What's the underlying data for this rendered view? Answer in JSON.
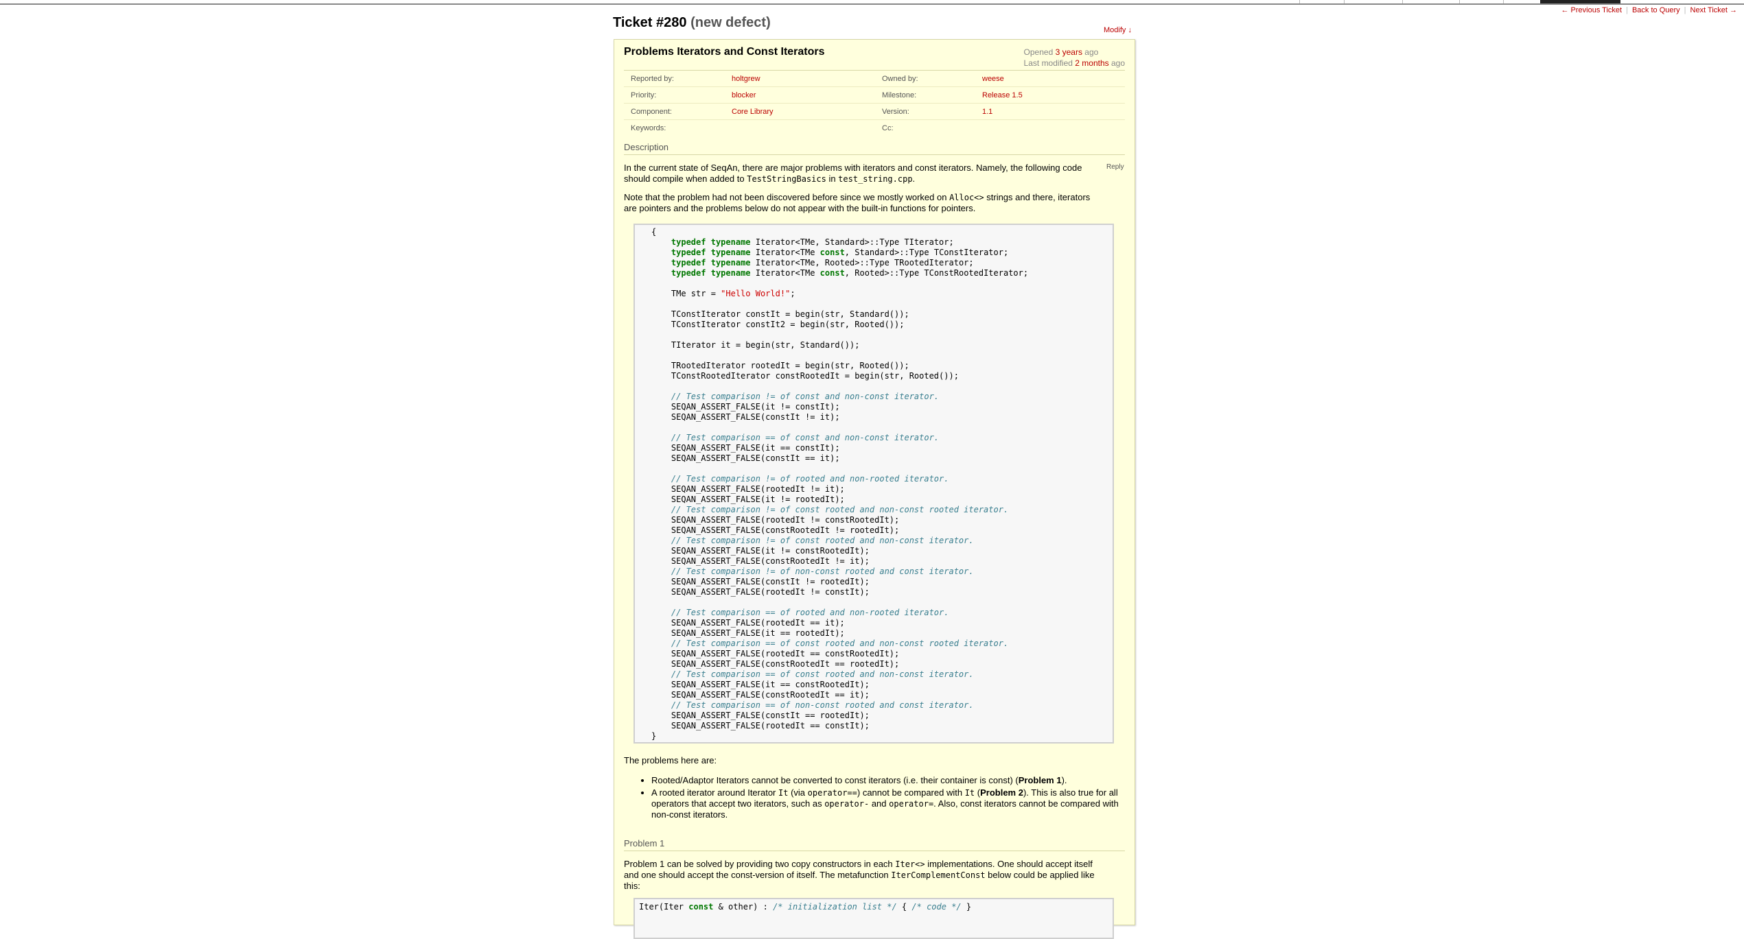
{
  "nav": {
    "prev": "← Previous Ticket",
    "back": "Back to Query",
    "next": "Next Ticket →"
  },
  "ticket": {
    "id_label": "Ticket #280",
    "status": "(new defect)",
    "modify_label": "Modify ↓",
    "summary": "Problems Iterators and Const Iterators",
    "opened_prefix": "Opened",
    "opened_ago": "3 years",
    "opened_suffix": "ago",
    "modified_prefix": "Last modified",
    "modified_ago": "2 months",
    "modified_suffix": "ago",
    "props": {
      "reported_by_label": "Reported by:",
      "reported_by": "holtgrew",
      "owned_by_label": "Owned by:",
      "owned_by": "weese",
      "priority_label": "Priority:",
      "priority": "blocker",
      "milestone_label": "Milestone:",
      "milestone": "Release 1.5",
      "component_label": "Component:",
      "component": "Core Library",
      "version_label": "Version:",
      "version": "1.1",
      "keywords_label": "Keywords:",
      "cc_label": "Cc:"
    },
    "description_heading": "Description",
    "reply_label": "Reply",
    "desc_p1_a": "In the current state of SeqAn, there are major problems with iterators and const iterators. Namely, the following code should compile when added to ",
    "desc_p1_code1": "TestStringBasics",
    "desc_p1_b": " in ",
    "desc_p1_code2": "test_string.cpp",
    "desc_p1_c": ".",
    "desc_p2_a": "Note that the problem had not been discovered before since we mostly worked on ",
    "desc_p2_code": "Alloc<>",
    "desc_p2_b": " strings and there, iterators are pointers and the problems below do not appear with the built-in functions for pointers.",
    "problems_intro": "The problems here are:",
    "bullet1_a": "Rooted/Adaptor Iterators cannot be converted to const iterators (i.e. their container is const) (",
    "bullet1_b": "Problem 1",
    "bullet1_c": ").",
    "bullet2_a": "A rooted iterator around Iterator ",
    "bullet2_code1": "It",
    "bullet2_b": " (via ",
    "bullet2_code2": "operator==",
    "bullet2_c": ") cannot be compared with ",
    "bullet2_code3": "It",
    "bullet2_d": " (",
    "bullet2_e": "Problem 2",
    "bullet2_f": "). This is also true for all operators that accept two iterators, such as ",
    "bullet2_code4": "operator-",
    "bullet2_g": " and ",
    "bullet2_code5": "operator=",
    "bullet2_h": ". Also, const iterators cannot be compared with non-const iterators.",
    "problem1_heading": "Problem 1",
    "problem1_a": "Problem 1 can be solved by providing two copy constructors in each ",
    "problem1_code1": "Iter<>",
    "problem1_b": " implementations. One should accept itself and one should accept the const-version of itself. The metafunction ",
    "problem1_code2": "IterComplementConst",
    "problem1_c": " below could be applied like this:"
  },
  "code_lines": [
    {
      "indent": 0,
      "parts": [
        {
          "t": "{"
        }
      ]
    },
    {
      "indent": 4,
      "parts": [
        {
          "k": "typedef"
        },
        {
          "t": " "
        },
        {
          "k": "typename"
        },
        {
          "t": " Iterator<TMe, Standard>::Type TIterator;"
        }
      ]
    },
    {
      "indent": 4,
      "parts": [
        {
          "k": "typedef"
        },
        {
          "t": " "
        },
        {
          "k": "typename"
        },
        {
          "t": " Iterator<TMe "
        },
        {
          "k": "const"
        },
        {
          "t": ", Standard>::Type TConstIterator;"
        }
      ]
    },
    {
      "indent": 4,
      "parts": [
        {
          "k": "typedef"
        },
        {
          "t": " "
        },
        {
          "k": "typename"
        },
        {
          "t": " Iterator<TMe, Rooted>::Type TRootedIterator;"
        }
      ]
    },
    {
      "indent": 4,
      "parts": [
        {
          "k": "typedef"
        },
        {
          "t": " "
        },
        {
          "k": "typename"
        },
        {
          "t": " Iterator<TMe "
        },
        {
          "k": "const"
        },
        {
          "t": ", Rooted>::Type TConstRootedIterator;"
        }
      ]
    },
    {
      "indent": 0,
      "parts": []
    },
    {
      "indent": 4,
      "parts": [
        {
          "t": "TMe str = "
        },
        {
          "s": "\"Hello World!\""
        },
        {
          "t": ";"
        }
      ]
    },
    {
      "indent": 0,
      "parts": []
    },
    {
      "indent": 4,
      "parts": [
        {
          "t": "TConstIterator constIt = begin(str, Standard());"
        }
      ]
    },
    {
      "indent": 4,
      "parts": [
        {
          "t": "TConstIterator constIt2 = begin(str, Rooted());"
        }
      ]
    },
    {
      "indent": 0,
      "parts": []
    },
    {
      "indent": 4,
      "parts": [
        {
          "t": "TIterator it = begin(str, Standard());"
        }
      ]
    },
    {
      "indent": 0,
      "parts": []
    },
    {
      "indent": 4,
      "parts": [
        {
          "t": "TRootedIterator rootedIt = begin(str, Rooted());"
        }
      ]
    },
    {
      "indent": 4,
      "parts": [
        {
          "t": "TConstRootedIterator constRootedIt = begin(str, Rooted());"
        }
      ]
    },
    {
      "indent": 0,
      "parts": []
    },
    {
      "indent": 4,
      "parts": [
        {
          "c": "// Test comparison != of const and non-const iterator."
        }
      ]
    },
    {
      "indent": 4,
      "parts": [
        {
          "t": "SEQAN_ASSERT_FALSE(it != constIt);"
        }
      ]
    },
    {
      "indent": 4,
      "parts": [
        {
          "t": "SEQAN_ASSERT_FALSE(constIt != it);"
        }
      ]
    },
    {
      "indent": 0,
      "parts": []
    },
    {
      "indent": 4,
      "parts": [
        {
          "c": "// Test comparison == of const and non-const iterator."
        }
      ]
    },
    {
      "indent": 4,
      "parts": [
        {
          "t": "SEQAN_ASSERT_FALSE(it == constIt);"
        }
      ]
    },
    {
      "indent": 4,
      "parts": [
        {
          "t": "SEQAN_ASSERT_FALSE(constIt == it);"
        }
      ]
    },
    {
      "indent": 0,
      "parts": []
    },
    {
      "indent": 4,
      "parts": [
        {
          "c": "// Test comparison != of rooted and non-rooted iterator."
        }
      ]
    },
    {
      "indent": 4,
      "parts": [
        {
          "t": "SEQAN_ASSERT_FALSE(rootedIt != it);"
        }
      ]
    },
    {
      "indent": 4,
      "parts": [
        {
          "t": "SEQAN_ASSERT_FALSE(it != rootedIt);"
        }
      ]
    },
    {
      "indent": 4,
      "parts": [
        {
          "c": "// Test comparison != of const rooted and non-const rooted iterator."
        }
      ]
    },
    {
      "indent": 4,
      "parts": [
        {
          "t": "SEQAN_ASSERT_FALSE(rootedIt != constRootedIt);"
        }
      ]
    },
    {
      "indent": 4,
      "parts": [
        {
          "t": "SEQAN_ASSERT_FALSE(constRootedIt != rootedIt);"
        }
      ]
    },
    {
      "indent": 4,
      "parts": [
        {
          "c": "// Test comparison != of const rooted and non-const iterator."
        }
      ]
    },
    {
      "indent": 4,
      "parts": [
        {
          "t": "SEQAN_ASSERT_FALSE(it != constRootedIt);"
        }
      ]
    },
    {
      "indent": 4,
      "parts": [
        {
          "t": "SEQAN_ASSERT_FALSE(constRootedIt != it);"
        }
      ]
    },
    {
      "indent": 4,
      "parts": [
        {
          "c": "// Test comparison != of non-const rooted and const iterator."
        }
      ]
    },
    {
      "indent": 4,
      "parts": [
        {
          "t": "SEQAN_ASSERT_FALSE(constIt != rootedIt);"
        }
      ]
    },
    {
      "indent": 4,
      "parts": [
        {
          "t": "SEQAN_ASSERT_FALSE(rootedIt != constIt);"
        }
      ]
    },
    {
      "indent": 0,
      "parts": []
    },
    {
      "indent": 4,
      "parts": [
        {
          "c": "// Test comparison == of rooted and non-rooted iterator."
        }
      ]
    },
    {
      "indent": 4,
      "parts": [
        {
          "t": "SEQAN_ASSERT_FALSE(rootedIt == it);"
        }
      ]
    },
    {
      "indent": 4,
      "parts": [
        {
          "t": "SEQAN_ASSERT_FALSE(it == rootedIt);"
        }
      ]
    },
    {
      "indent": 4,
      "parts": [
        {
          "c": "// Test comparison == of const rooted and non-const rooted iterator."
        }
      ]
    },
    {
      "indent": 4,
      "parts": [
        {
          "t": "SEQAN_ASSERT_FALSE(rootedIt == constRootedIt);"
        }
      ]
    },
    {
      "indent": 4,
      "parts": [
        {
          "t": "SEQAN_ASSERT_FALSE(constRootedIt == rootedIt);"
        }
      ]
    },
    {
      "indent": 4,
      "parts": [
        {
          "c": "// Test comparison == of const rooted and non-const iterator."
        }
      ]
    },
    {
      "indent": 4,
      "parts": [
        {
          "t": "SEQAN_ASSERT_FALSE(it == constRootedIt);"
        }
      ]
    },
    {
      "indent": 4,
      "parts": [
        {
          "t": "SEQAN_ASSERT_FALSE(constRootedIt == it);"
        }
      ]
    },
    {
      "indent": 4,
      "parts": [
        {
          "c": "// Test comparison == of non-const rooted and const iterator."
        }
      ]
    },
    {
      "indent": 4,
      "parts": [
        {
          "t": "SEQAN_ASSERT_FALSE(constIt == rootedIt);"
        }
      ]
    },
    {
      "indent": 4,
      "parts": [
        {
          "t": "SEQAN_ASSERT_FALSE(rootedIt == constIt);"
        }
      ]
    },
    {
      "indent": 0,
      "parts": [
        {
          "t": "}"
        }
      ]
    }
  ],
  "code2_lines": [
    {
      "indent": 0,
      "parts": [
        {
          "t": "Iter(Iter "
        },
        {
          "k": "const"
        },
        {
          "t": " & other) : "
        },
        {
          "c": "/* initialization list */"
        },
        {
          "t": " { "
        },
        {
          "c": "/* code */"
        },
        {
          "t": " }"
        }
      ]
    }
  ]
}
